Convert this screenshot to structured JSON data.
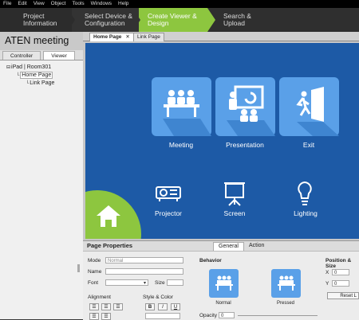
{
  "menu": [
    "File",
    "Edit",
    "View",
    "Object",
    "Tools",
    "Windows",
    "Help"
  ],
  "wizard": {
    "steps": [
      {
        "line1": "Project",
        "line2": "Information"
      },
      {
        "line1": "Select Device &",
        "line2": "Configuration"
      },
      {
        "line1": "Create Viewer &",
        "line2": "Design"
      },
      {
        "line1": "Search &",
        "line2": "Upload"
      }
    ],
    "active_color": "#8dc63f"
  },
  "left": {
    "app_title": "ATEN meeting",
    "tabs": [
      "Controller",
      "Viewer"
    ],
    "tree": {
      "root": "iPad | Room301",
      "pages": [
        "Home Page",
        "Link Page"
      ]
    }
  },
  "doc_tabs": [
    "Home Page",
    "Link Page"
  ],
  "canvas": {
    "background": "#1d5aa6",
    "tiles": [
      {
        "label": "Meeting",
        "icon": "meeting-icon"
      },
      {
        "label": "Presentation",
        "icon": "presentation-icon"
      },
      {
        "label": "Exit",
        "icon": "exit-icon"
      }
    ],
    "devices": [
      {
        "label": "Projector",
        "icon": "projector-icon"
      },
      {
        "label": "Screen",
        "icon": "screen-icon"
      },
      {
        "label": "Lighting",
        "icon": "lightbulb-icon"
      }
    ],
    "home_icon": "home-icon"
  },
  "props": {
    "title": "Page Properties",
    "tabs": [
      "General",
      "Action"
    ],
    "mode_label": "Mode",
    "mode_value": "Normal",
    "name_label": "Name",
    "font_label": "Font",
    "size_label": "Size",
    "alignment_label": "Alignment",
    "style_label": "Style & Color",
    "style_buttons": [
      "B",
      "I",
      "U"
    ],
    "behavior_label": "Behavior",
    "normal_label": "Normal",
    "pressed_label": "Pressed",
    "opacity_label": "Opacity",
    "opacity_value": "0",
    "position_label": "Position & Size",
    "x_label": "X",
    "x_value": "0",
    "y_label": "Y",
    "y_value": "0",
    "reset_label": "Reset L"
  }
}
